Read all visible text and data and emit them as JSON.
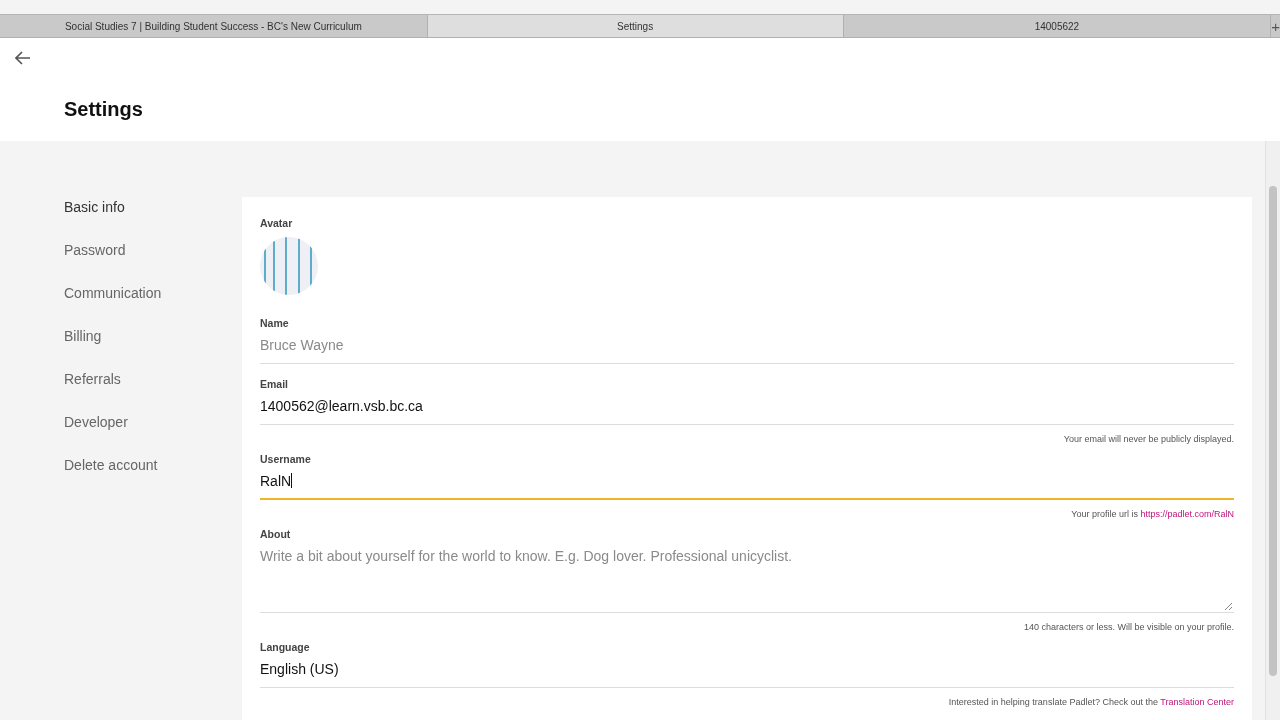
{
  "browser_tabs": [
    {
      "label": "Social Studies 7 | Building Student Success - BC's New Curriculum",
      "selected": false
    },
    {
      "label": "Settings",
      "selected": true
    },
    {
      "label": "14005622",
      "selected": false
    }
  ],
  "new_tab": "+",
  "page_title": "Settings",
  "sidebar": {
    "items": [
      {
        "label": "Basic info",
        "selected": true
      },
      {
        "label": "Password",
        "selected": false
      },
      {
        "label": "Communication",
        "selected": false
      },
      {
        "label": "Billing",
        "selected": false
      },
      {
        "label": "Referrals",
        "selected": false
      },
      {
        "label": "Developer",
        "selected": false
      },
      {
        "label": "Delete account",
        "selected": false
      }
    ]
  },
  "avatar": {
    "label": "Avatar"
  },
  "fields": [
    {
      "kind": "text",
      "label": "Name",
      "placeholder": "Bruce Wayne",
      "focused": false
    },
    {
      "kind": "text",
      "label": "Email",
      "value": "1400562@learn.vsb.bc.ca",
      "focused": false,
      "hint": "Your email will never be publicly displayed."
    },
    {
      "kind": "text",
      "label": "Username",
      "value": "RalN",
      "focused": true,
      "hint": "Your profile url is ",
      "hint_link": "https://padlet.com/RalN"
    },
    {
      "kind": "textarea",
      "label": "About",
      "placeholder": "Write a bit about yourself for the world to know. E.g. Dog lover. Professional unicyclist.",
      "focused": false,
      "hint": "140 characters or less. Will be visible on your profile."
    },
    {
      "kind": "text",
      "label": "Language",
      "value": "English (US)",
      "focused": false,
      "hint": "Interested in helping translate Padlet? Check out the ",
      "hint_link": "Translation Center"
    }
  ]
}
